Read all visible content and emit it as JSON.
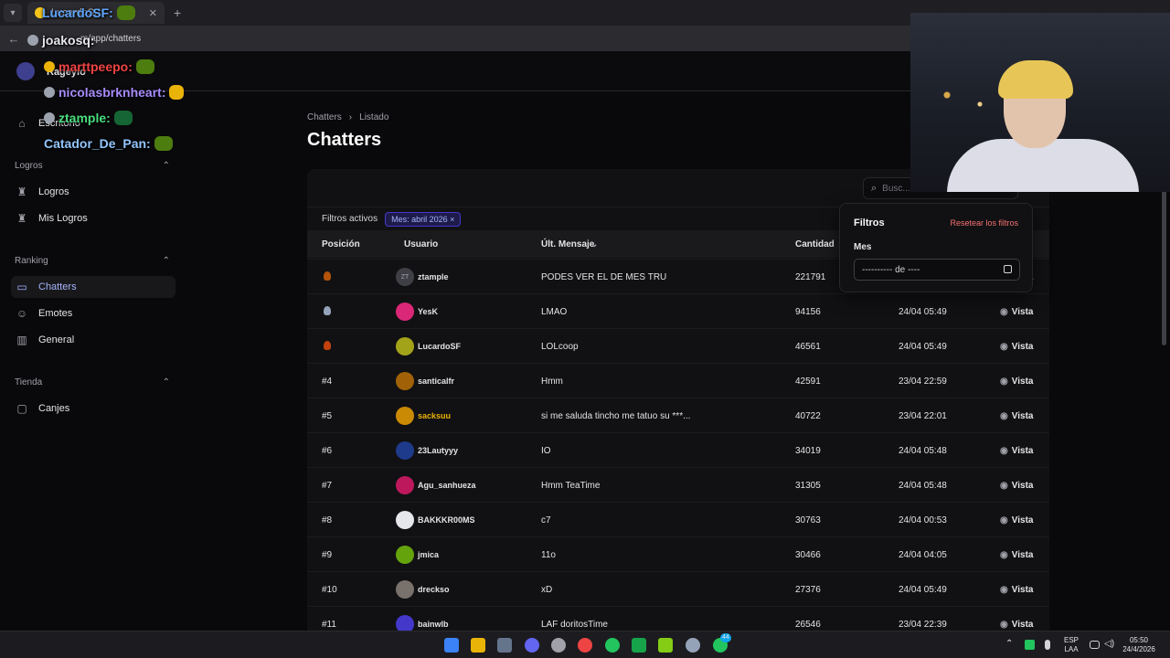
{
  "browser": {
    "tab_title": "LucardoSF:",
    "url": "m/app/chatters"
  },
  "header": {
    "username": "Rageyio"
  },
  "sidebar": {
    "desk": "Escritorio",
    "sections": [
      {
        "title": "Logros",
        "items": [
          "Logros",
          "Mis Logros"
        ]
      },
      {
        "title": "Ranking",
        "items": [
          "Chatters",
          "Emotes",
          "General"
        ]
      },
      {
        "title": "Tienda",
        "items": [
          "Canjes"
        ]
      }
    ]
  },
  "main": {
    "breadcrumb": [
      "Chatters",
      "Listado"
    ],
    "title": "Chatters",
    "search_placeholder": "Busc...",
    "active_filters_label": "Filtros activos",
    "filter_chip": "Mes: abril 2026 ×",
    "columns": [
      "Posición",
      "Usuario",
      "Últ. Mensaje",
      "Cantidad"
    ],
    "view_label": "Vista",
    "rows": [
      {
        "pos": "",
        "medal": "#b45309",
        "user": "ztample",
        "msg": "PODES VER EL DE MES TRU",
        "count": "221791",
        "date": "",
        "avatar": "#3f3f46",
        "initials": "ZT"
      },
      {
        "pos": "",
        "medal": "#94a3b8",
        "user": "YesK",
        "msg": "LMAO",
        "count": "94156",
        "date": "24/04 05:49",
        "avatar": "#db2777"
      },
      {
        "pos": "",
        "medal": "#c2410c",
        "user": "LucardoSF",
        "msg": "LOLcoop",
        "count": "46561",
        "date": "24/04 05:49",
        "avatar": "#a3a31a"
      },
      {
        "pos": "#4",
        "user": "santicalfr",
        "msg": "Hmm",
        "count": "42591",
        "date": "23/04 22:59",
        "avatar": "#a16207"
      },
      {
        "pos": "#5",
        "user": "sacksuu",
        "msg": "si me saluda tincho me tatuo su ***...",
        "count": "40722",
        "date": "23/04 22:01",
        "avatar": "#ca8a04",
        "highlight": "#eab308"
      },
      {
        "pos": "#6",
        "user": "23Lautyyy",
        "msg": "IO",
        "count": "34019",
        "date": "24/04 05:48",
        "avatar": "#1e3a8a"
      },
      {
        "pos": "#7",
        "user": "Agu_sanhueza",
        "msg": "Hmm TeaTime",
        "count": "31305",
        "date": "24/04 05:48",
        "avatar": "#be185d"
      },
      {
        "pos": "#8",
        "user": "BAKKKR00MS",
        "msg": "c7",
        "count": "30763",
        "date": "24/04 00:53",
        "avatar": "#e5e7eb"
      },
      {
        "pos": "#9",
        "user": "jmica",
        "msg": "11o",
        "count": "30466",
        "date": "24/04 04:05",
        "avatar": "#65a30d"
      },
      {
        "pos": "#10",
        "user": "drecksо",
        "msg": "xD",
        "count": "27376",
        "date": "24/04 05:49",
        "avatar": "#78716c"
      },
      {
        "pos": "#11",
        "user": "bainwlb",
        "msg": "LAF doritosTime",
        "count": "26546",
        "date": "23/04 22:39",
        "avatar": "#4338ca"
      }
    ]
  },
  "popover": {
    "title": "Filtros",
    "reset": "Resetear los filtros",
    "field_label": "Mes",
    "field_value": "---------- de ----"
  },
  "chat": [
    {
      "name": "LucardoSF:",
      "color": "#60a5fa"
    },
    {
      "name": "joakosq:",
      "color": "#e5e7eb"
    },
    {
      "name": "marttpeepo:",
      "color": "#ef4444"
    },
    {
      "name": "nicolasbrknheart:",
      "color": "#a78bfa"
    },
    {
      "name": "ztample:",
      "color": "#4ade80"
    },
    {
      "name": "Catador_De_Pan:",
      "color": "#93c5fd"
    }
  ],
  "taskbar": {
    "lang_top": "ESP",
    "lang_bottom": "LAA",
    "time": "05:50",
    "date": "24/4/2026",
    "badge": "44"
  }
}
